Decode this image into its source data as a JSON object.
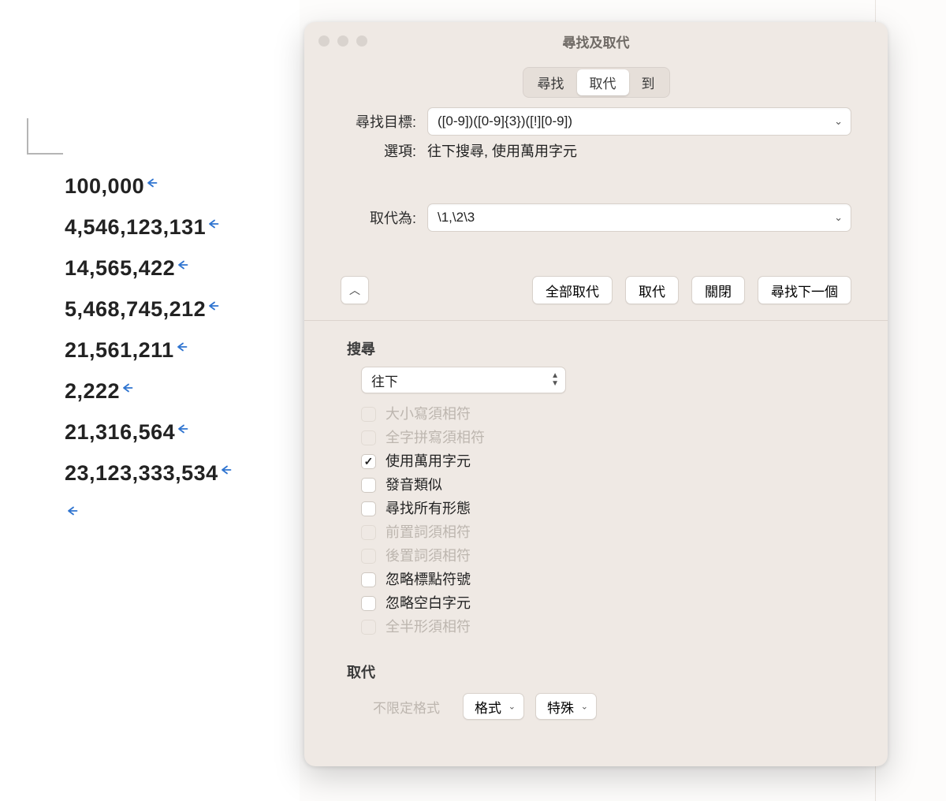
{
  "document": {
    "lines": [
      "100,000",
      "4,546,123,131",
      "14,565,422",
      "5,468,745,212",
      "21,561,211",
      "2,222",
      "21,316,564",
      "23,123,333,534"
    ],
    "trailing_empty": true
  },
  "dialog": {
    "title": "尋找及取代",
    "tabs": {
      "find": "尋找",
      "replace": "取代",
      "goto": "到",
      "active": "replace"
    },
    "find": {
      "label": "尋找目標:",
      "value": "([0-9])([0-9]{3})([!][0-9])"
    },
    "options_row": {
      "label": "選項:",
      "value": "往下搜尋, 使用萬用字元"
    },
    "replace": {
      "label": "取代為:",
      "value": "\\1,\\2\\3"
    },
    "buttons": {
      "collapse": "︿",
      "replace_all": "全部取代",
      "replace_one": "取代",
      "close": "關閉",
      "find_next": "尋找下一個"
    },
    "search_section": {
      "header": "搜尋",
      "direction_selected": "往下",
      "checks": [
        {
          "label": "大小寫須相符",
          "checked": false,
          "disabled": true
        },
        {
          "label": "全字拼寫須相符",
          "checked": false,
          "disabled": true
        },
        {
          "label": "使用萬用字元",
          "checked": true,
          "disabled": false
        },
        {
          "label": "發音類似",
          "checked": false,
          "disabled": false
        },
        {
          "label": "尋找所有形態",
          "checked": false,
          "disabled": false
        },
        {
          "label": "前置詞須相符",
          "checked": false,
          "disabled": true
        },
        {
          "label": "後置詞須相符",
          "checked": false,
          "disabled": true
        },
        {
          "label": "忽略標點符號",
          "checked": false,
          "disabled": false
        },
        {
          "label": "忽略空白字元",
          "checked": false,
          "disabled": false
        },
        {
          "label": "全半形須相符",
          "checked": false,
          "disabled": true
        }
      ]
    },
    "replace_section": {
      "header": "取代",
      "no_format": "不限定格式",
      "format": "格式",
      "special": "特殊"
    }
  }
}
